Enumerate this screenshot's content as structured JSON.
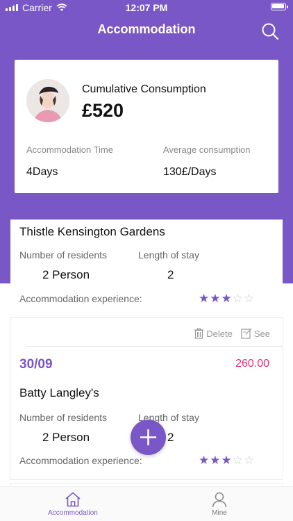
{
  "status_bar": {
    "carrier": "Carrier",
    "time": "12:07 PM"
  },
  "nav": {
    "title": "Accommodation",
    "search_icon": "search-icon"
  },
  "summary": {
    "label": "Cumulative Consumption",
    "amount": "£520",
    "time_label": "Accommodation Time",
    "time_value": "4Days",
    "avg_label": "Average consumption",
    "avg_value": "130£/Days"
  },
  "records": [
    {
      "name": "Thistle Kensington Gardens",
      "residents_label": "Number of residents",
      "residents_value": "2 Person",
      "stay_label": "Length of stay",
      "stay_value": "2",
      "experience_label": "Accommodation experience:",
      "rating": 3,
      "rating_max": 5
    },
    {
      "delete_label": "Delete",
      "see_label": "See",
      "date": "30/09",
      "price": "260.00",
      "name": "Batty Langley's",
      "residents_label": "Number of residents",
      "residents_value": "2 Person",
      "stay_label": "Length of stay",
      "stay_value": "2",
      "experience_label": "Accommodation experience:",
      "rating": 3,
      "rating_max": 5
    }
  ],
  "tab_bar": {
    "items": [
      {
        "label": "Accommodation",
        "icon": "home-icon",
        "active": true
      },
      {
        "label": "Mine",
        "icon": "user-icon",
        "active": false
      }
    ]
  },
  "colors": {
    "accent": "#7a57c6",
    "price": "#e0336a"
  }
}
